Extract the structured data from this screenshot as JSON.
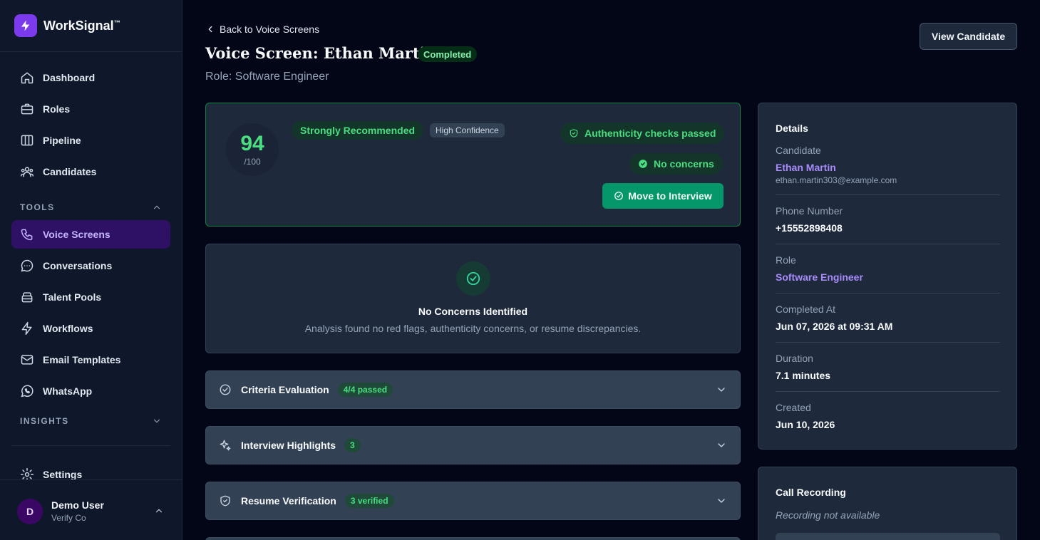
{
  "brand": {
    "name": "WorkSignal",
    "mark": "™"
  },
  "sidebar": {
    "main_items": [
      {
        "label": "Dashboard",
        "icon": "home-icon"
      },
      {
        "label": "Roles",
        "icon": "briefcase-icon"
      },
      {
        "label": "Pipeline",
        "icon": "columns-icon"
      },
      {
        "label": "Candidates",
        "icon": "users-icon"
      }
    ],
    "tools_label": "TOOLS",
    "tools_items": [
      {
        "label": "Voice Screens",
        "icon": "phone-icon",
        "active": true
      },
      {
        "label": "Conversations",
        "icon": "chat-bubble-icon"
      },
      {
        "label": "Talent Pools",
        "icon": "database-icon"
      },
      {
        "label": "Workflows",
        "icon": "bolt-icon"
      },
      {
        "label": "Email Templates",
        "icon": "mail-icon"
      },
      {
        "label": "WhatsApp",
        "icon": "whatsapp-icon"
      }
    ],
    "insights_label": "INSIGHTS",
    "settings_label": "Settings"
  },
  "user": {
    "initial": "D",
    "name": "Demo User",
    "org": "Verify Co"
  },
  "header": {
    "back_label": "Back to Voice Screens",
    "title": "Voice Screen: Ethan Martin",
    "status": "Completed",
    "role_line": "Role: Software Engineer",
    "view_button": "View Candidate"
  },
  "score": {
    "value": "94",
    "max": "/100",
    "recommendation": "Strongly Recommended",
    "confidence": "High Confidence",
    "authenticity": "Authenticity checks passed",
    "concerns": "No concerns",
    "move_button": "Move to Interview"
  },
  "concerns_panel": {
    "title": "No Concerns Identified",
    "subtitle": "Analysis found no red flags, authenticity concerns, or resume discrepancies."
  },
  "sections": [
    {
      "title": "Criteria Evaluation",
      "badge": "4/4 passed",
      "icon": "check-circle-icon"
    },
    {
      "title": "Interview Highlights",
      "badge": "3",
      "icon": "sparkles-icon"
    },
    {
      "title": "Resume Verification",
      "badge": "3 verified",
      "icon": "shield-check-icon"
    }
  ],
  "details": {
    "heading": "Details",
    "candidate_label": "Candidate",
    "candidate_name": "Ethan Martin",
    "candidate_email": "ethan.martin303@example.com",
    "phone_label": "Phone Number",
    "phone": "+15552898408",
    "role_label": "Role",
    "role": "Software Engineer",
    "completed_label": "Completed At",
    "completed": "Jun 07, 2026 at 09:31 AM",
    "duration_label": "Duration",
    "duration": "7.1 minutes",
    "created_label": "Created",
    "created": "Jun 10, 2026"
  },
  "recording": {
    "title": "Call Recording",
    "status": "Recording not available"
  },
  "colors": {
    "accent": "#7c3aed",
    "success": "#4ade80",
    "primary_button": "#059669",
    "link": "#a78bfa"
  }
}
